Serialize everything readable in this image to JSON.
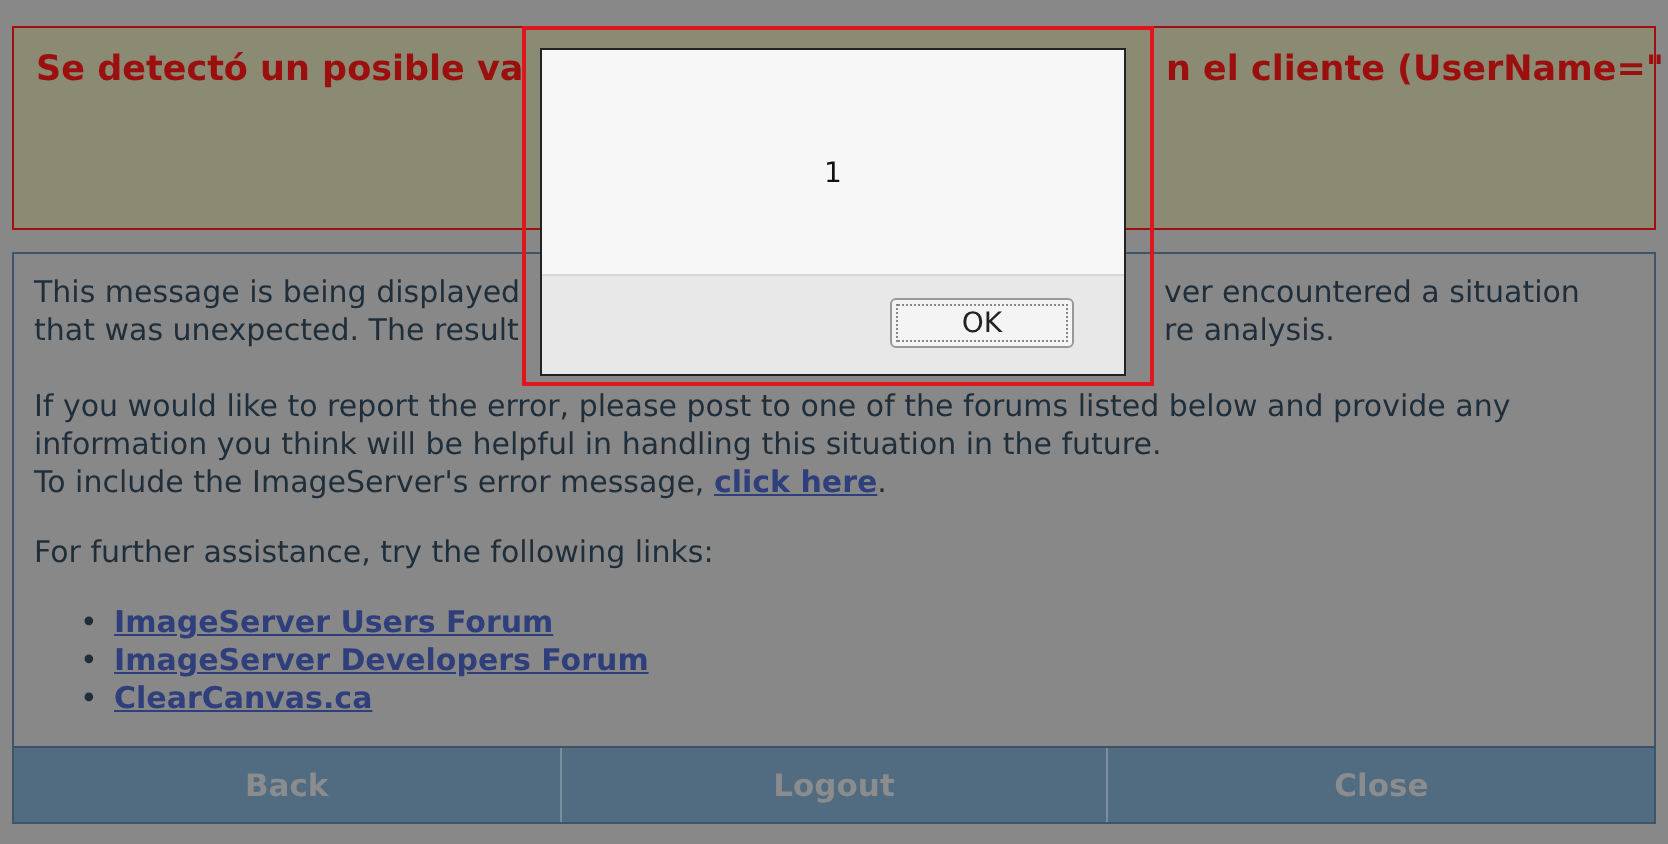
{
  "heading": {
    "left": "Se detectó un posible va",
    "right": "n el cliente (UserName=\""
  },
  "message_lines": [
    {
      "left": "This message is being displayed",
      "right": "ver encountered a situation"
    },
    {
      "left": "that was unexpected. The result",
      "right": "re analysis."
    }
  ],
  "report_lines": [
    "If you would like to report the error, please post to one of the forums listed below and provide any",
    "information you think will be helpful in handling this situation in the future."
  ],
  "include": {
    "text": "To include the ImageServer's error message, ",
    "link": "click here",
    "end": "."
  },
  "assistance": "For further assistance, try the following links:",
  "links": [
    {
      "bullet": "•",
      "label": "ImageServer Users Forum"
    },
    {
      "bullet": "•",
      "label": "ImageServer Developers Forum"
    },
    {
      "bullet": "•",
      "label": "ClearCanvas.ca"
    }
  ],
  "footer_buttons": [
    "Back",
    "Logout",
    "Close"
  ],
  "dialog": {
    "message": "1",
    "button": "OK"
  }
}
